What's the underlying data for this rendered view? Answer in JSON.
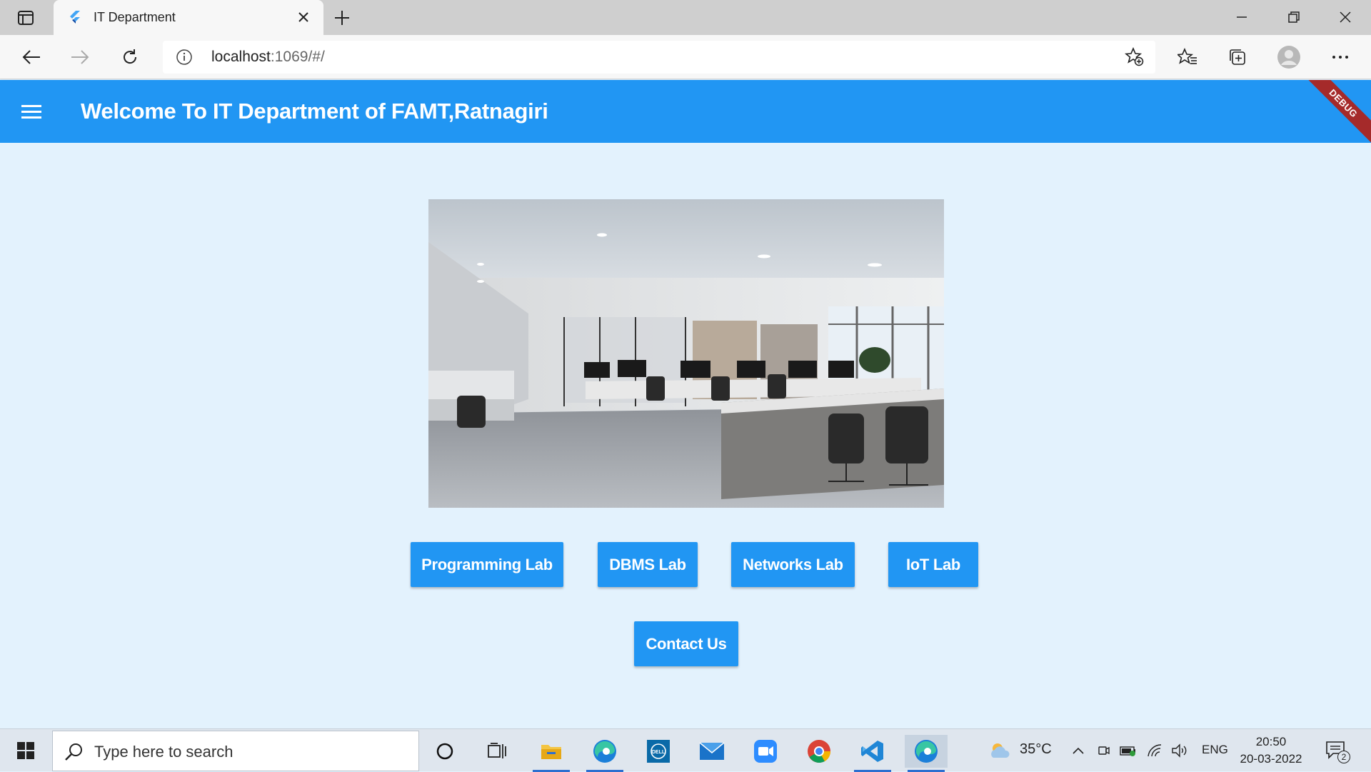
{
  "browser": {
    "tab_title": "IT Department",
    "url_host": "localhost",
    "url_rest": ":1069/#/"
  },
  "app": {
    "title": "Welcome To IT Department of FAMT,Ratnagiri",
    "debug_label": "DEBUG",
    "primary_color": "#2196f3",
    "background_color": "#e3f2fd",
    "hero_image": "office-interior-photo",
    "buttons": {
      "programming": "Programming Lab",
      "dbms": "DBMS Lab",
      "networks": "Networks Lab",
      "iot": "IoT Lab",
      "contact": "Contact Us"
    }
  },
  "taskbar": {
    "search_placeholder": "Type here to search",
    "weather": "35°C",
    "language": "ENG",
    "time": "20:50",
    "date": "20-03-2022",
    "notification_count": "2"
  }
}
